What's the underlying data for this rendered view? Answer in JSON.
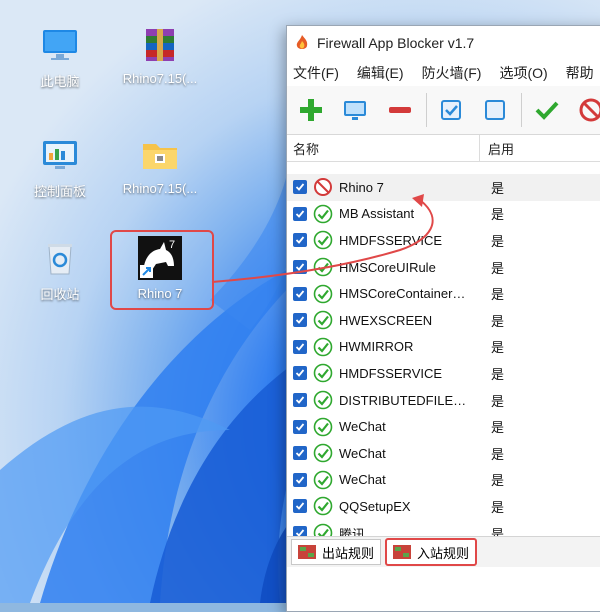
{
  "desktop": {
    "icons": [
      {
        "label": "此电脑"
      },
      {
        "label": "Rhino7.15(..."
      },
      {
        "label": "控制面板"
      },
      {
        "label": "Rhino7.15(..."
      },
      {
        "label": "回收站"
      },
      {
        "label": "Rhino 7"
      }
    ]
  },
  "app": {
    "title": "Firewall App Blocker v1.7",
    "menu": [
      "文件(F)",
      "编辑(E)",
      "防火墙(F)",
      "选项(O)",
      "帮助"
    ],
    "columns": {
      "name": "名称",
      "enabled": "启用"
    },
    "rows": [
      {
        "name": "Rhino 7",
        "enabled": "是",
        "status": "blocked"
      },
      {
        "name": "MB Assistant",
        "enabled": "是",
        "status": "allowed"
      },
      {
        "name": "HMDFSSERVICE",
        "enabled": "是",
        "status": "allowed"
      },
      {
        "name": "HMSCoreUIRule",
        "enabled": "是",
        "status": "allowed"
      },
      {
        "name": "HMSCoreContainer…",
        "enabled": "是",
        "status": "allowed"
      },
      {
        "name": "HWEXSCREEN",
        "enabled": "是",
        "status": "allowed"
      },
      {
        "name": "HWMIRROR",
        "enabled": "是",
        "status": "allowed"
      },
      {
        "name": "HMDFSSERVICE",
        "enabled": "是",
        "status": "allowed"
      },
      {
        "name": "DISTRIBUTEDFILE…",
        "enabled": "是",
        "status": "allowed"
      },
      {
        "name": "WeChat",
        "enabled": "是",
        "status": "allowed"
      },
      {
        "name": "WeChat",
        "enabled": "是",
        "status": "allowed"
      },
      {
        "name": "WeChat",
        "enabled": "是",
        "status": "allowed"
      },
      {
        "name": "QQSetupEX",
        "enabled": "是",
        "status": "allowed"
      },
      {
        "name": "腾讯...",
        "enabled": "是",
        "status": "allowed"
      }
    ],
    "tabs": {
      "outbound": "出站规则",
      "inbound": "入站规则"
    }
  },
  "colors": {
    "accent": "#2166c8",
    "highlight": "#e04848",
    "allow": "#2fa82f",
    "block": "#d33a3a"
  }
}
